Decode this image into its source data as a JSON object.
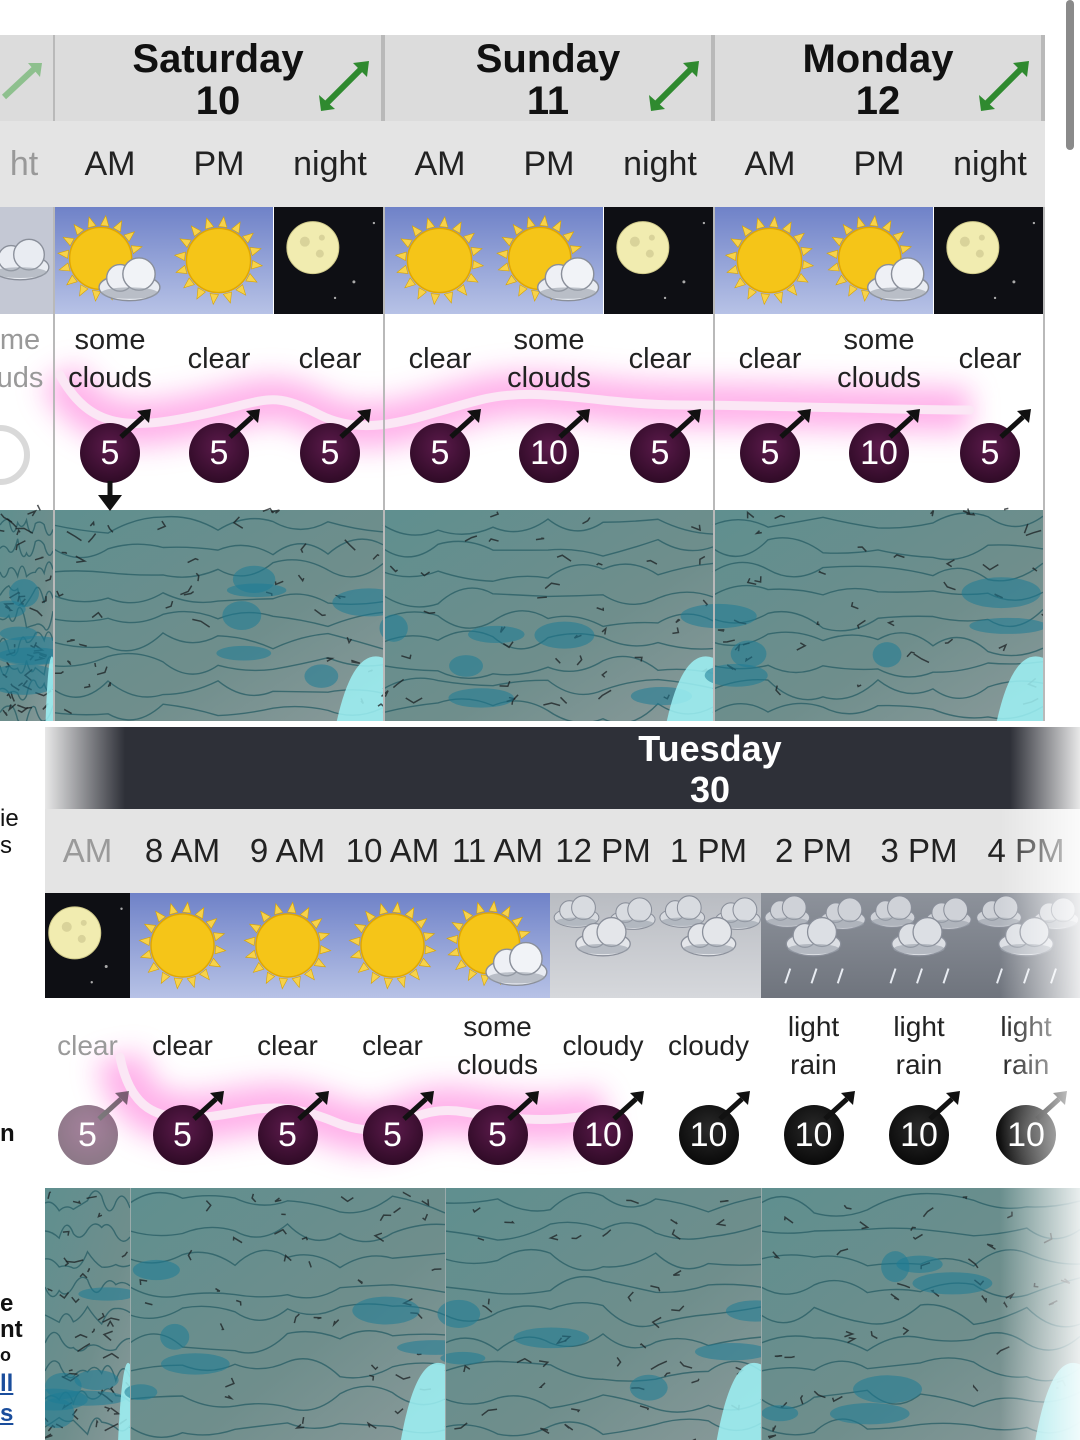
{
  "top_forecast": {
    "days": [
      {
        "name": "Saturday",
        "date": "10"
      },
      {
        "name": "Sunday",
        "date": "11"
      },
      {
        "name": "Monday",
        "date": "12"
      }
    ],
    "left_edge_fragments": {
      "period": "ht",
      "condition_line1": "me",
      "condition_line2": "uds"
    },
    "periods": [
      "AM",
      "PM",
      "night",
      "AM",
      "PM",
      "night",
      "AM",
      "PM",
      "night"
    ],
    "conditions": [
      [
        "some",
        "clouds"
      ],
      [
        "clear"
      ],
      [
        "clear"
      ],
      [
        "clear"
      ],
      [
        "some",
        "clouds"
      ],
      [
        "clear"
      ],
      [
        "clear"
      ],
      [
        "some",
        "clouds"
      ],
      [
        "clear"
      ]
    ],
    "icons": [
      "sun-cloud-icon",
      "sun-icon",
      "moon-icon",
      "sun-icon",
      "sun-cloud-icon",
      "moon-icon",
      "sun-icon",
      "sun-cloud-icon",
      "moon-icon"
    ],
    "wind_speeds": [
      "5",
      "5",
      "5",
      "5",
      "10",
      "5",
      "5",
      "10",
      "5"
    ]
  },
  "bottom_forecast": {
    "day": {
      "name": "Tuesday",
      "date": "30"
    },
    "hours": [
      "AM",
      "8 AM",
      "9 AM",
      "10 AM",
      "11 AM",
      "12 PM",
      "1 PM",
      "2 PM",
      "3 PM",
      "4 PM"
    ],
    "conditions": [
      [
        "clear"
      ],
      [
        "clear"
      ],
      [
        "clear"
      ],
      [
        "clear"
      ],
      [
        "some",
        "clouds"
      ],
      [
        "cloudy"
      ],
      [
        "cloudy"
      ],
      [
        "light",
        "rain"
      ],
      [
        "light",
        "rain"
      ],
      [
        "light",
        "rain"
      ]
    ],
    "icons": [
      "moon-icon",
      "sun-icon",
      "sun-icon",
      "sun-icon",
      "sun-cloud-icon",
      "cloud-icon",
      "cloud-icon",
      "rain-cloud-icon",
      "rain-cloud-icon",
      "rain-cloud-icon"
    ],
    "wind_speeds": [
      "5",
      "5",
      "5",
      "5",
      "5",
      "10",
      "10",
      "10",
      "10",
      "10"
    ]
  },
  "left_fragments": [
    "ie",
    "s",
    "n",
    "e",
    "nt",
    "o",
    "ll",
    "s"
  ],
  "colors": {
    "header_gray": "#dcdcdc",
    "day_band_dark": "#2e3038",
    "wind_dark_purple": "#3a0a2e",
    "wind_black": "#0a0a0a",
    "highlight_pink": "#ff6fd8",
    "sun_yellow": "#f5c518",
    "map_teal": "#3f8a8a"
  }
}
